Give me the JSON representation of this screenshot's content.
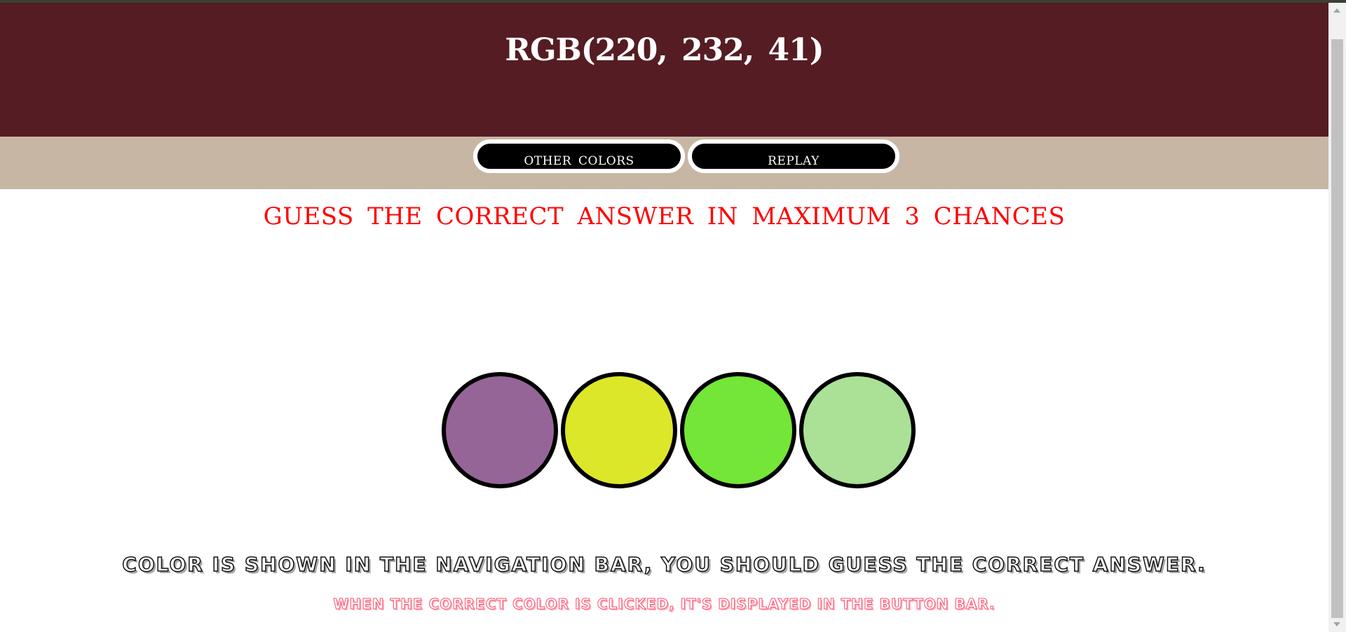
{
  "header": {
    "rgb_text": "RGB(220, 232, 41)"
  },
  "buttons": {
    "other_colors": "OTHER COLORS",
    "replay": "REPLAY"
  },
  "instruction": "GUESS THE CORRECT ANSWER IN MAXIMUM 3 CHANCES",
  "options": [
    {
      "color": "#956598"
    },
    {
      "color": "#dce729"
    },
    {
      "color": "#73e637"
    },
    {
      "color": "#aae196"
    }
  ],
  "footer": {
    "line1": "COLOR IS SHOWN IN THE NAVIGATION BAR, YOU SHOULD GUESS THE CORRECT ANSWER.",
    "line2": "WHEN THE CORRECT COLOR IS CLICKED, IT'S DISPLAYED IN THE BUTTON BAR."
  },
  "colors": {
    "header_bg": "#551c23",
    "buttonbar_bg": "#c8b6a4",
    "instruction_text": "#ff0000"
  }
}
